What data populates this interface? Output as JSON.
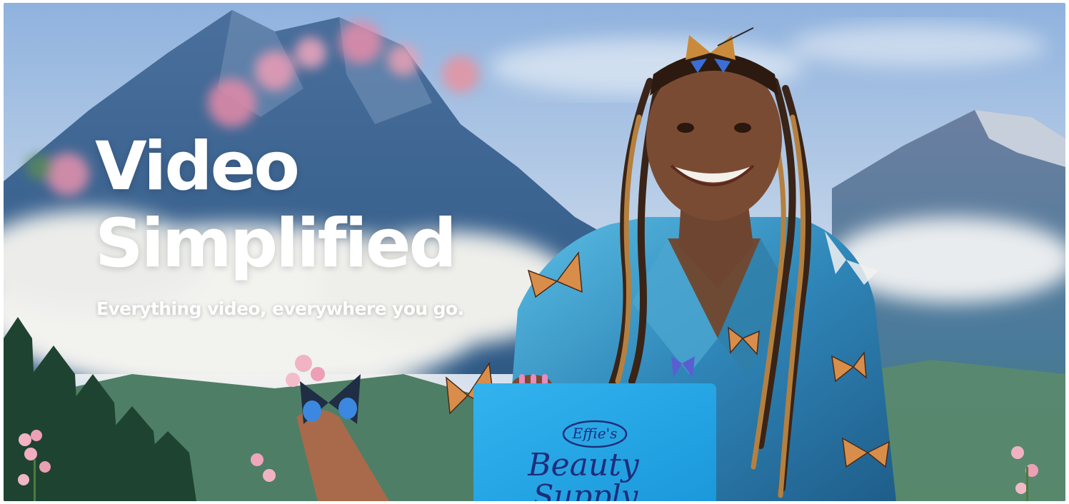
{
  "hero": {
    "headline_line1": "Video",
    "headline_line2": "Simplified",
    "tagline": "Everything video, everywhere you go."
  },
  "laptop": {
    "brand_line1": "Effie's",
    "brand_line2": "Beauty",
    "brand_line3": "Supply"
  },
  "colors": {
    "sky": "#b9cde6",
    "mountain": "#3f6c98",
    "cloud": "#eef0f1",
    "forest": "#1f4a34",
    "laptop": "#1ea6e6",
    "jacket": "#3a95c0",
    "headline": "#ffffff"
  }
}
